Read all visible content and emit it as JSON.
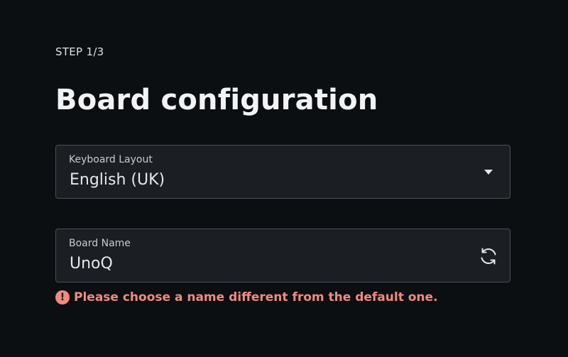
{
  "step_label": "STEP 1/3",
  "title": "Board configuration",
  "keyboard_layout": {
    "label": "Keyboard Layout",
    "value": "English (UK)",
    "icon": "dropdown-arrow-icon"
  },
  "board_name": {
    "label": "Board Name",
    "value": "UnoQ",
    "icon": "refresh-icon"
  },
  "error": {
    "icon": "exclamation-icon",
    "glyph": "!",
    "message": "Please choose a name different from the default one."
  },
  "colors": {
    "background": "#0c0f12",
    "field_background": "#1b1f23",
    "field_border": "#4a4f55",
    "error": "#f08b7d"
  }
}
